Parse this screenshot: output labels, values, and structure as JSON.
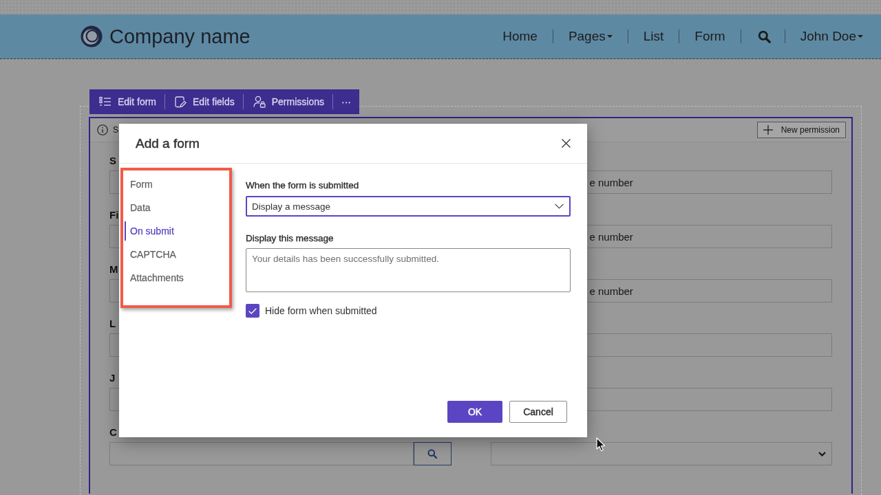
{
  "header": {
    "brand": "Company name",
    "nav": [
      {
        "kind": "link",
        "label": "Home"
      },
      {
        "kind": "dropdown",
        "label": "Pages"
      },
      {
        "kind": "link",
        "label": "List"
      },
      {
        "kind": "link",
        "label": "Form"
      },
      {
        "kind": "search"
      },
      {
        "kind": "dropdown",
        "label": "John Doe"
      }
    ]
  },
  "toolbar": {
    "items": [
      {
        "kind": "command",
        "label": "Edit form"
      },
      {
        "kind": "command",
        "label": "Edit fields"
      },
      {
        "kind": "command",
        "label": "Permissions"
      },
      {
        "kind": "overflow",
        "label": "···"
      }
    ]
  },
  "info_bar": {
    "text": "S",
    "button": "New permission"
  },
  "form": {
    "left_fields": [
      {
        "kind": "text",
        "label": "S"
      },
      {
        "kind": "text",
        "label": "Fi"
      },
      {
        "kind": "text",
        "label": "M"
      },
      {
        "kind": "text",
        "label": "L"
      },
      {
        "kind": "text",
        "label": "J"
      },
      {
        "kind": "lookup",
        "label": "C"
      }
    ],
    "right_fields": [
      {
        "kind": "text",
        "value": "e number"
      },
      {
        "kind": "text",
        "value": "e number"
      },
      {
        "kind": "text",
        "value": "e number"
      },
      {
        "kind": "text"
      },
      {
        "kind": "text"
      },
      {
        "kind": "select"
      }
    ]
  },
  "dialog": {
    "title": "Add a form",
    "nav": [
      {
        "label": "Form",
        "selected": false
      },
      {
        "label": "Data",
        "selected": false
      },
      {
        "label": "On submit",
        "selected": true
      },
      {
        "label": "CAPTCHA",
        "selected": false
      },
      {
        "label": "Attachments",
        "selected": false
      }
    ],
    "submit_action": {
      "label": "When the form is submitted",
      "value": "Display a message"
    },
    "message": {
      "label": "Display this message",
      "placeholder": "Your details has been successfully submitted."
    },
    "hide_form": {
      "label": "Hide form when submitted",
      "checked": true
    },
    "buttons": [
      {
        "kind": "primary",
        "label": "OK"
      },
      {
        "kind": "secondary",
        "label": "Cancel"
      }
    ]
  }
}
